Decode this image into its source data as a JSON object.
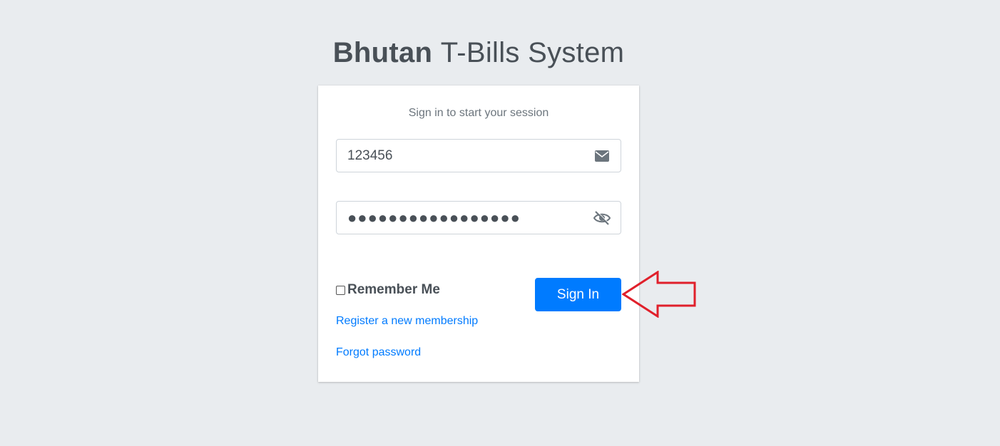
{
  "logo": {
    "strong": "Bhutan",
    "light": "T-Bills System"
  },
  "login": {
    "message": "Sign in to start your session",
    "email_value": "123456",
    "password_mask": "●●●●●●●●●●●●●●●●●",
    "remember_label": "Remember Me",
    "signin_label": "Sign In",
    "register_link": "Register a new membership",
    "forgot_link": "Forgot password"
  },
  "icons": {
    "email": "envelope-icon",
    "password": "eye-slash-icon",
    "annotation": "red-arrow-left"
  },
  "colors": {
    "background": "#e9ecef",
    "primary": "#007bff",
    "arrow": "#e0202b"
  }
}
